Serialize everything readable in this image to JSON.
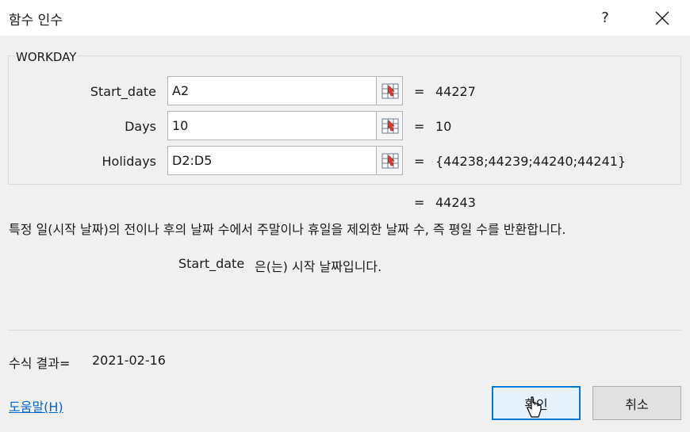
{
  "window": {
    "title": "함수 인수",
    "help_label": "?",
    "close_icon": "close-icon"
  },
  "function": {
    "name": "WORKDAY",
    "arguments": [
      {
        "label": "Start_date",
        "value": "A2",
        "result": "44227"
      },
      {
        "label": "Days",
        "value": "10",
        "result": "10"
      },
      {
        "label": "Holidays",
        "value": "D2:D5",
        "result": "{44238;44239;44240;44241}"
      }
    ],
    "equals": "=",
    "result": "44243",
    "description": "특정 일(시작 날짜)의 전이나 후의 날짜 수에서 주말이나 휴일을 제외한 날짜 수, 즉 평일 수를 반환합니다.",
    "arg_desc_name": "Start_date",
    "arg_desc_text": "은(는) 시작 날짜입니다."
  },
  "formula": {
    "label": "수식 결과=",
    "value": "2021-02-16"
  },
  "footer": {
    "help_link": "도움말(H)",
    "ok_label": "확인",
    "cancel_label": "취소"
  },
  "colors": {
    "accent": "#0078d7",
    "link": "#0066cc",
    "background": "#f0f0f0"
  }
}
